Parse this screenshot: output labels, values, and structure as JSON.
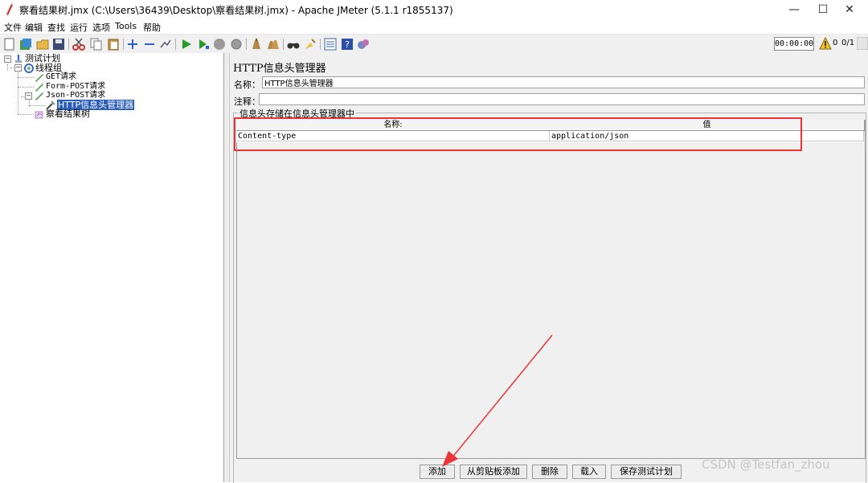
{
  "window": {
    "title": "察看结果树.jmx (C:\\Users\\36439\\Desktop\\察看结果树.jmx) - Apache JMeter (5.1.1 r1855137)",
    "minimize_glyph": "—",
    "maximize_glyph": "☐",
    "close_glyph": "✕"
  },
  "menu": {
    "items": [
      "文件",
      "编辑",
      "查找",
      "运行",
      "选项",
      "Tools",
      "帮助"
    ]
  },
  "toolbar": {
    "icons": [
      "new-icon",
      "templates-icon",
      "open-icon",
      "save-icon",
      "cut-icon",
      "copy-icon",
      "paste-icon",
      "expand-icon",
      "collapse-icon",
      "toggle-icon",
      "start-icon",
      "start-no-pause-icon",
      "stop-icon",
      "shutdown-icon",
      "clear-icon",
      "clear-all-icon",
      "search-icon",
      "reset-search-icon",
      "function-helper-icon",
      "help-icon",
      "remote-icon"
    ],
    "timer": "00:00:00",
    "warning_count": "0",
    "thread_count": "0/1"
  },
  "tree": {
    "nodes": [
      {
        "label": "测试计划",
        "icon": "test-plan-icon"
      },
      {
        "label": "线程组",
        "icon": "thread-group-icon"
      },
      {
        "label": "GET请求",
        "icon": "http-sampler-icon"
      },
      {
        "label": "Form-POST请求",
        "icon": "http-sampler-icon"
      },
      {
        "label": "Json-POST请求",
        "icon": "http-sampler-icon"
      },
      {
        "label": "HTTP信息头管理器",
        "icon": "config-element-icon"
      },
      {
        "label": "察看结果树",
        "icon": "listener-icon"
      }
    ]
  },
  "panel": {
    "title": "HTTP信息头管理器",
    "name_label": "名称：",
    "name_value": "HTTP信息头管理器",
    "comment_label": "注释：",
    "comment_value": "",
    "group_label": "信息头存储在信息头管理器中",
    "table": {
      "columns": [
        "名称:",
        "值"
      ],
      "rows": [
        [
          "Content-type",
          "application/json"
        ]
      ]
    },
    "buttons": [
      "添加",
      "从剪贴板添加",
      "删除",
      "载入",
      "保存测试计划"
    ]
  },
  "annotation": {
    "highlight_color": "#e8363a"
  },
  "watermark": "CSDN @Testfan_zhou"
}
